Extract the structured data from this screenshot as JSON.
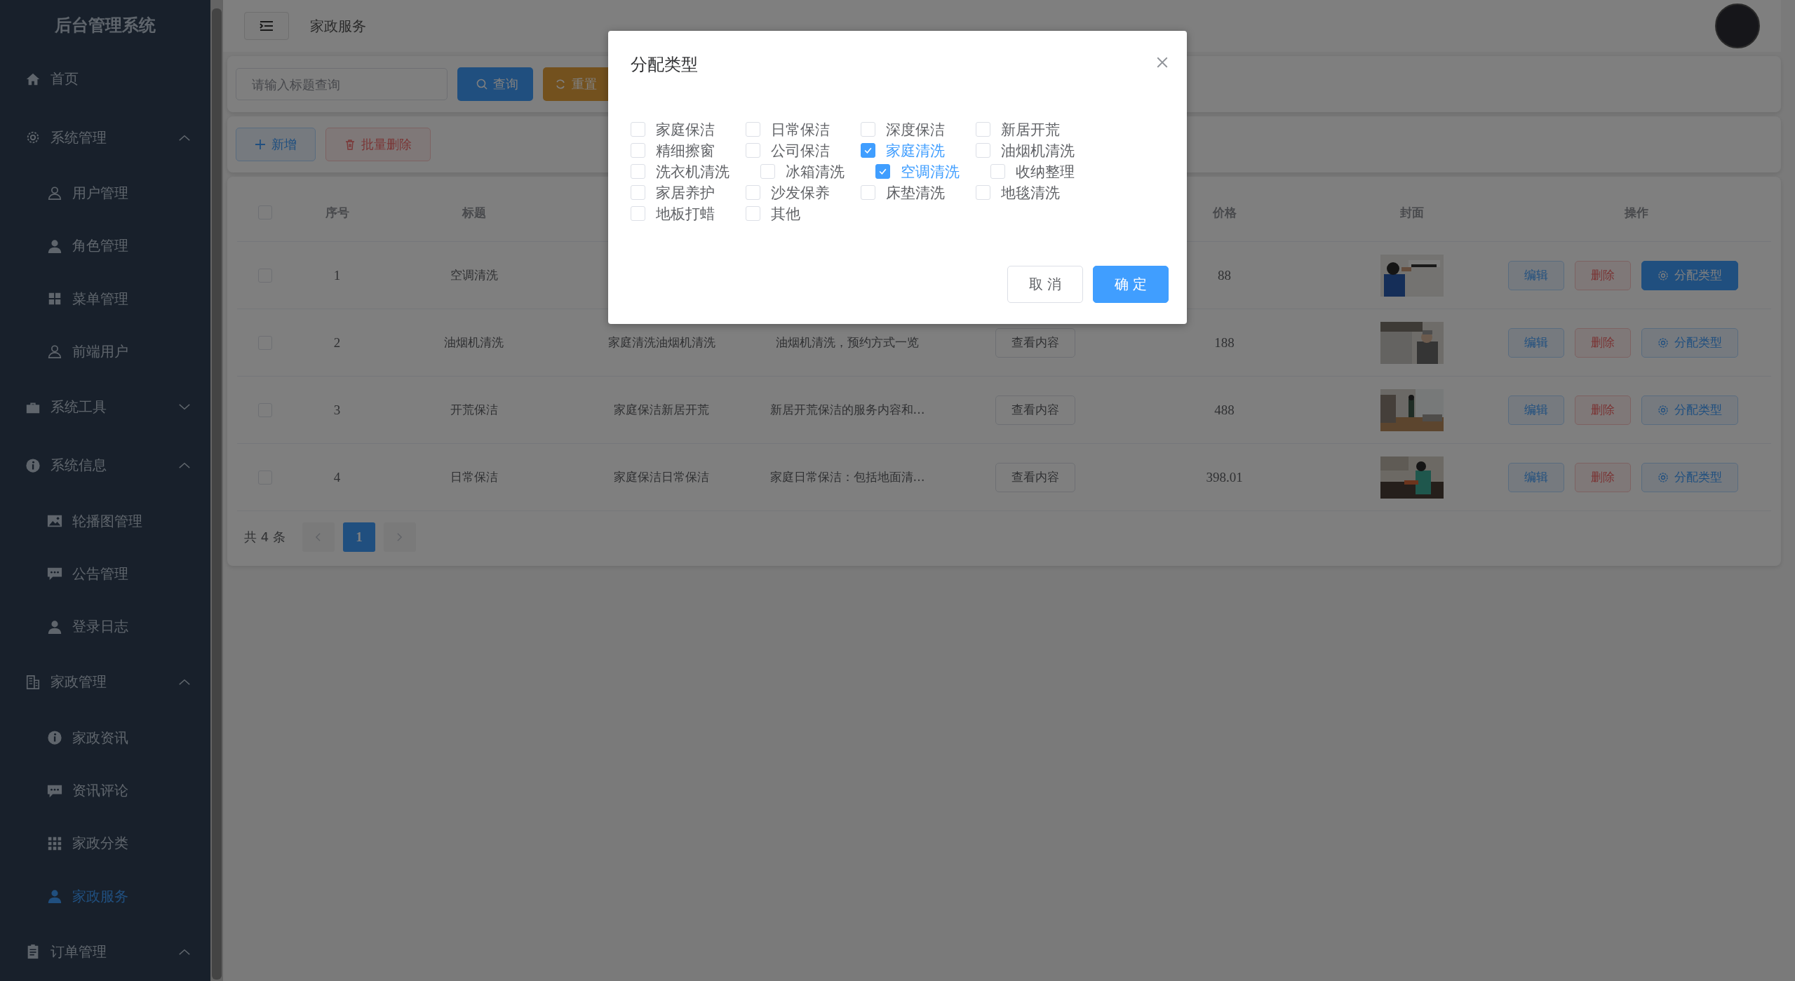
{
  "sidebar": {
    "title": "后台管理系统",
    "items": [
      {
        "label": "首页",
        "selected": false
      },
      {
        "label": "系统管理",
        "selected": false,
        "expanded": true,
        "children": [
          {
            "label": "用户管理",
            "selected": false
          },
          {
            "label": "角色管理",
            "selected": false
          },
          {
            "label": "菜单管理",
            "selected": false
          },
          {
            "label": "前端用户",
            "selected": false
          }
        ]
      },
      {
        "label": "系统工具",
        "selected": false,
        "expanded": false
      },
      {
        "label": "系统信息",
        "selected": false,
        "expanded": true,
        "children": [
          {
            "label": "轮播图管理",
            "selected": false
          },
          {
            "label": "公告管理",
            "selected": false
          },
          {
            "label": "登录日志",
            "selected": false
          }
        ]
      },
      {
        "label": "家政管理",
        "selected": false,
        "expanded": true,
        "children": [
          {
            "label": "家政资讯",
            "selected": false
          },
          {
            "label": "资讯评论",
            "selected": false
          },
          {
            "label": "家政分类",
            "selected": false
          },
          {
            "label": "家政服务",
            "selected": true
          }
        ]
      },
      {
        "label": "订单管理",
        "selected": false,
        "expanded": true
      }
    ]
  },
  "header": {
    "breadcrumb": "家政服务"
  },
  "search": {
    "placeholder": "请输入标题查询",
    "search_button": "查询",
    "reset_button": "重置"
  },
  "toolbar": {
    "add_button": "新增",
    "batch_delete_button": "批量删除"
  },
  "table": {
    "columns": [
      {
        "kind": "index",
        "label": "序号"
      },
      {
        "kind": "title",
        "label": "标题"
      },
      {
        "kind": "price",
        "label": "价格"
      },
      {
        "kind": "cover",
        "label": "封面"
      },
      {
        "kind": "actions",
        "label": "操作"
      }
    ],
    "header_checked": false,
    "rows": [
      {
        "checked": false,
        "index": "1",
        "title": "空调清洗",
        "price": "88",
        "edit": "编辑",
        "delete": "删除",
        "assign": "分配类型",
        "assign_active": true
      },
      {
        "checked": false,
        "index": "2",
        "title": "油烟机清洗",
        "type": "家庭清洗油烟机清洗",
        "summary": "油烟机清洗，预约方式一览",
        "content_button": "查看内容",
        "price": "188",
        "edit": "编辑",
        "delete": "删除",
        "assign": "分配类型",
        "assign_active": false
      },
      {
        "checked": false,
        "index": "3",
        "title": "开荒保洁",
        "type": "家庭保洁新居开荒",
        "summary": "新居开荒保洁的服务内容和…",
        "content_button": "查看内容",
        "price": "488",
        "edit": "编辑",
        "delete": "删除",
        "assign": "分配类型",
        "assign_active": false
      },
      {
        "checked": false,
        "index": "4",
        "title": "日常保洁",
        "type": "家庭保洁日常保洁",
        "summary": "家庭日常保洁：包括地面清…",
        "content_button": "查看内容",
        "price": "398.01",
        "edit": "编辑",
        "delete": "删除",
        "assign": "分配类型",
        "assign_active": false
      }
    ]
  },
  "pagination": {
    "total": "共 4 条",
    "pages": [
      {
        "label": "1",
        "selected": true
      }
    ]
  },
  "dialog": {
    "title": "分配类型",
    "cancel_button": "取 消",
    "confirm_button": "确 定",
    "options": [
      {
        "label": "家庭保洁",
        "checked": false
      },
      {
        "label": "日常保洁",
        "checked": false
      },
      {
        "label": "深度保洁",
        "checked": false
      },
      {
        "label": "新居开荒",
        "checked": false
      },
      {
        "label": "精细擦窗",
        "checked": false
      },
      {
        "label": "公司保洁",
        "checked": false
      },
      {
        "label": "家庭清洗",
        "checked": true
      },
      {
        "label": "油烟机清洗",
        "checked": false
      },
      {
        "label": "洗衣机清洗",
        "checked": false
      },
      {
        "label": "冰箱清洗",
        "checked": false
      },
      {
        "label": "空调清洗",
        "checked": true
      },
      {
        "label": "收纳整理",
        "checked": false
      },
      {
        "label": "家居养护",
        "checked": false
      },
      {
        "label": "沙发保养",
        "checked": false
      },
      {
        "label": "床垫清洗",
        "checked": false
      },
      {
        "label": "地毯清洗",
        "checked": false
      },
      {
        "label": "地板打蜡",
        "checked": false
      },
      {
        "label": "其他",
        "checked": false
      }
    ]
  }
}
